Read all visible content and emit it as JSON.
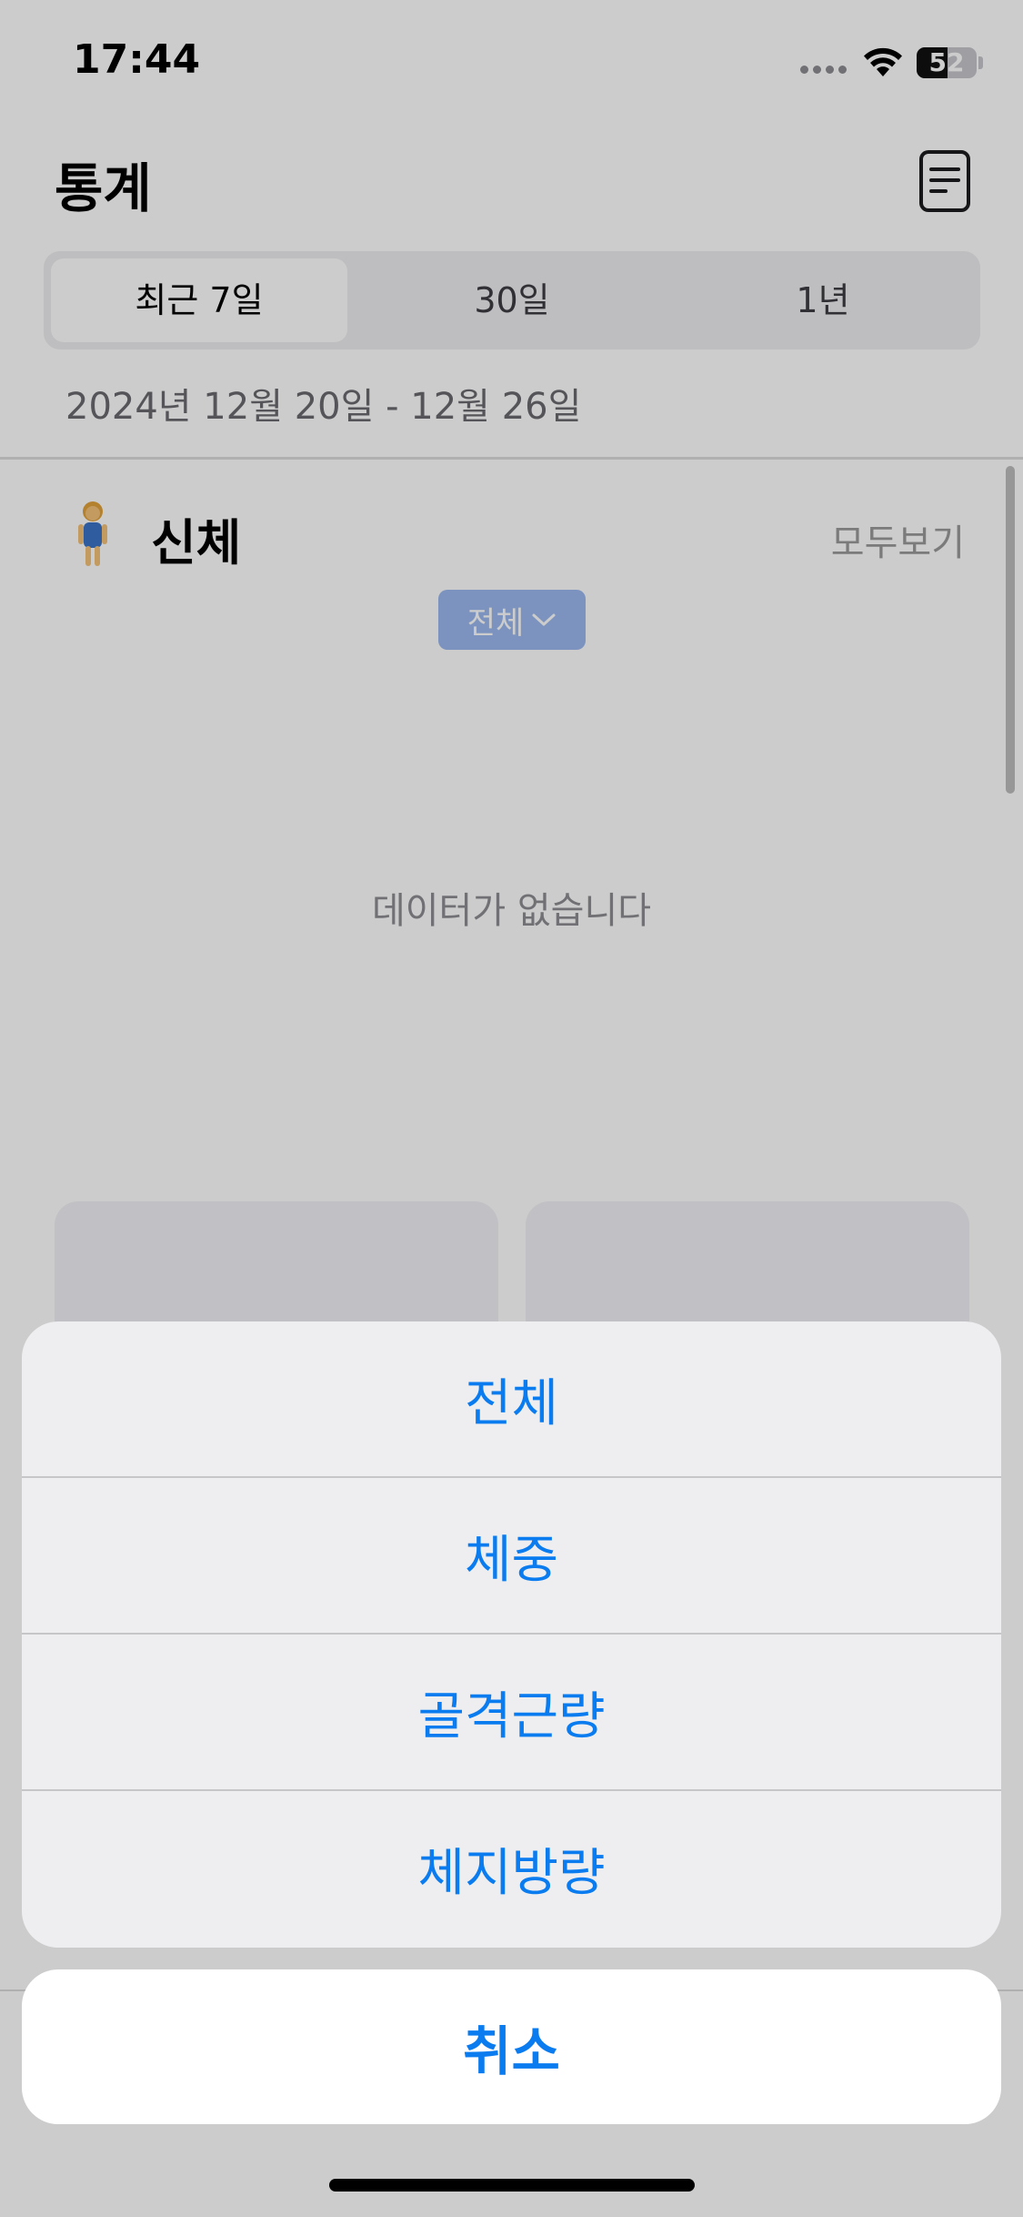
{
  "status_bar": {
    "time": "17:44",
    "battery_level": "52",
    "icons": [
      "signal-icon",
      "wifi-icon",
      "battery-icon"
    ]
  },
  "nav": {
    "title": "통계",
    "report_icon": "report-icon"
  },
  "period_tabs": [
    {
      "label": "최근 7일",
      "selected": true
    },
    {
      "label": "30일",
      "selected": false
    },
    {
      "label": "1년",
      "selected": false
    }
  ],
  "date_range": "2024년 12월 20일  -  12월 26일",
  "body_section": {
    "icon": "standing-woman-emoji",
    "title": "신체",
    "see_all": "모두보기",
    "filter_label": "전체",
    "empty_message": "데이터가 없습니다"
  },
  "action_sheet": {
    "options": [
      "전체",
      "체중",
      "골격근량",
      "체지방량"
    ],
    "cancel": "취소"
  },
  "colors": {
    "accent": "#0a7cf0",
    "chip": "#9ab8ee",
    "dim_overlay": "rgba(0,0,0,0.2)"
  }
}
